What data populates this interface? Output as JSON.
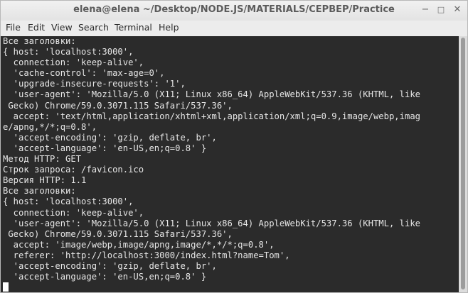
{
  "window": {
    "title": "elena@elena ~/Desktop/NODE.JS/MATERIALS/CEPBEP/Practice",
    "minimize_glyph": "−",
    "maximize_glyph": "□",
    "close_glyph": "✕"
  },
  "menu": {
    "items": [
      "File",
      "Edit",
      "View",
      "Search",
      "Terminal",
      "Help"
    ]
  },
  "terminal": {
    "lines": [
      "Все заголовки:",
      "{ host: 'localhost:3000',",
      "  connection: 'keep-alive',",
      "  'cache-control': 'max-age=0',",
      "  'upgrade-insecure-requests': '1',",
      "  'user-agent': 'Mozilla/5.0 (X11; Linux x86_64) AppleWebKit/537.36 (KHTML, like",
      " Gecko) Chrome/59.0.3071.115 Safari/537.36',",
      "  accept: 'text/html,application/xhtml+xml,application/xml;q=0.9,image/webp,imag",
      "e/apng,*/*;q=0.8',",
      "  'accept-encoding': 'gzip, deflate, br',",
      "  'accept-language': 'en-US,en;q=0.8' }",
      "Метод HTTP: GET",
      "Строк запроса: /favicon.ico",
      "Версия HTTP: 1.1",
      "Все заголовки:",
      "{ host: 'localhost:3000',",
      "  connection: 'keep-alive',",
      "  'user-agent': 'Mozilla/5.0 (X11; Linux x86_64) AppleWebKit/537.36 (KHTML, like",
      " Gecko) Chrome/59.0.3071.115 Safari/537.36',",
      "  accept: 'image/webp,image/apng,image/*,*/*;q=0.8',",
      "  referer: 'http://localhost:3000/index.html?name=Tom',",
      "  'accept-encoding': 'gzip, deflate, br',",
      "  'accept-language': 'en-US,en;q=0.8' }"
    ]
  },
  "colors": {
    "terminal_bg": "#2b2b2b",
    "terminal_fg": "#e6e6e6",
    "cursor": "#ffffff"
  }
}
